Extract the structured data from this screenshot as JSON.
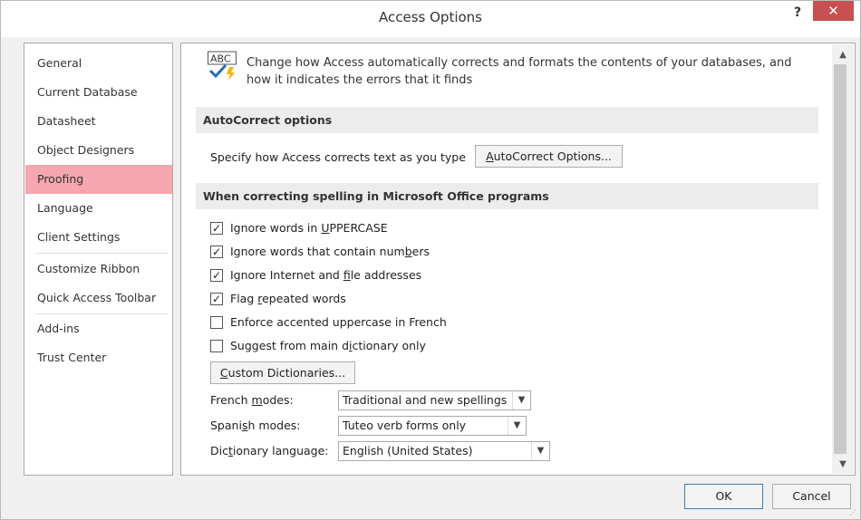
{
  "window": {
    "title": "Access Options",
    "help": "?",
    "close": "✕"
  },
  "nav": {
    "items": [
      {
        "label": "General"
      },
      {
        "label": "Current Database"
      },
      {
        "label": "Datasheet"
      },
      {
        "label": "Object Designers"
      },
      {
        "label": "Proofing",
        "selected": true
      },
      {
        "label": "Language"
      },
      {
        "label": "Client Settings"
      },
      {
        "label": "Customize Ribbon"
      },
      {
        "label": "Quick Access Toolbar"
      },
      {
        "label": "Add-ins"
      },
      {
        "label": "Trust Center"
      }
    ]
  },
  "main": {
    "header_icon_text": "ABC",
    "header_line1": "Change how Access automatically corrects and formats the contents of your databases, and",
    "header_line2": "how it indicates the errors that it finds",
    "autocorrect": {
      "section": "AutoCorrect options",
      "label": "Specify how Access corrects text as you type",
      "button": "AutoCorrect Options..."
    },
    "spelling": {
      "section": "When correcting spelling in Microsoft Office programs",
      "options": [
        {
          "label": "Ignore words in UPPERCASE",
          "checked": true
        },
        {
          "label": "Ignore words that contain numbers",
          "checked": true
        },
        {
          "label": "Ignore Internet and file addresses",
          "checked": true
        },
        {
          "label": "Flag repeated words",
          "checked": true
        },
        {
          "label": "Enforce accented uppercase in French",
          "checked": false
        },
        {
          "label": "Suggest from main dictionary only",
          "checked": false
        }
      ],
      "dictionaries_button": "Custom Dictionaries...",
      "french_modes": {
        "label": "French modes:",
        "value": "Traditional and new spellings"
      },
      "spanish_modes": {
        "label": "Spanish modes:",
        "value": "Tuteo verb forms only"
      },
      "dictionary_language": {
        "label": "Dictionary language:",
        "value": "English (United States)"
      }
    }
  },
  "footer": {
    "ok": "OK",
    "cancel": "Cancel"
  },
  "colors": {
    "selected_nav": "#f5a6ae",
    "close_button": "#c75050",
    "section_bg": "#ececec"
  }
}
